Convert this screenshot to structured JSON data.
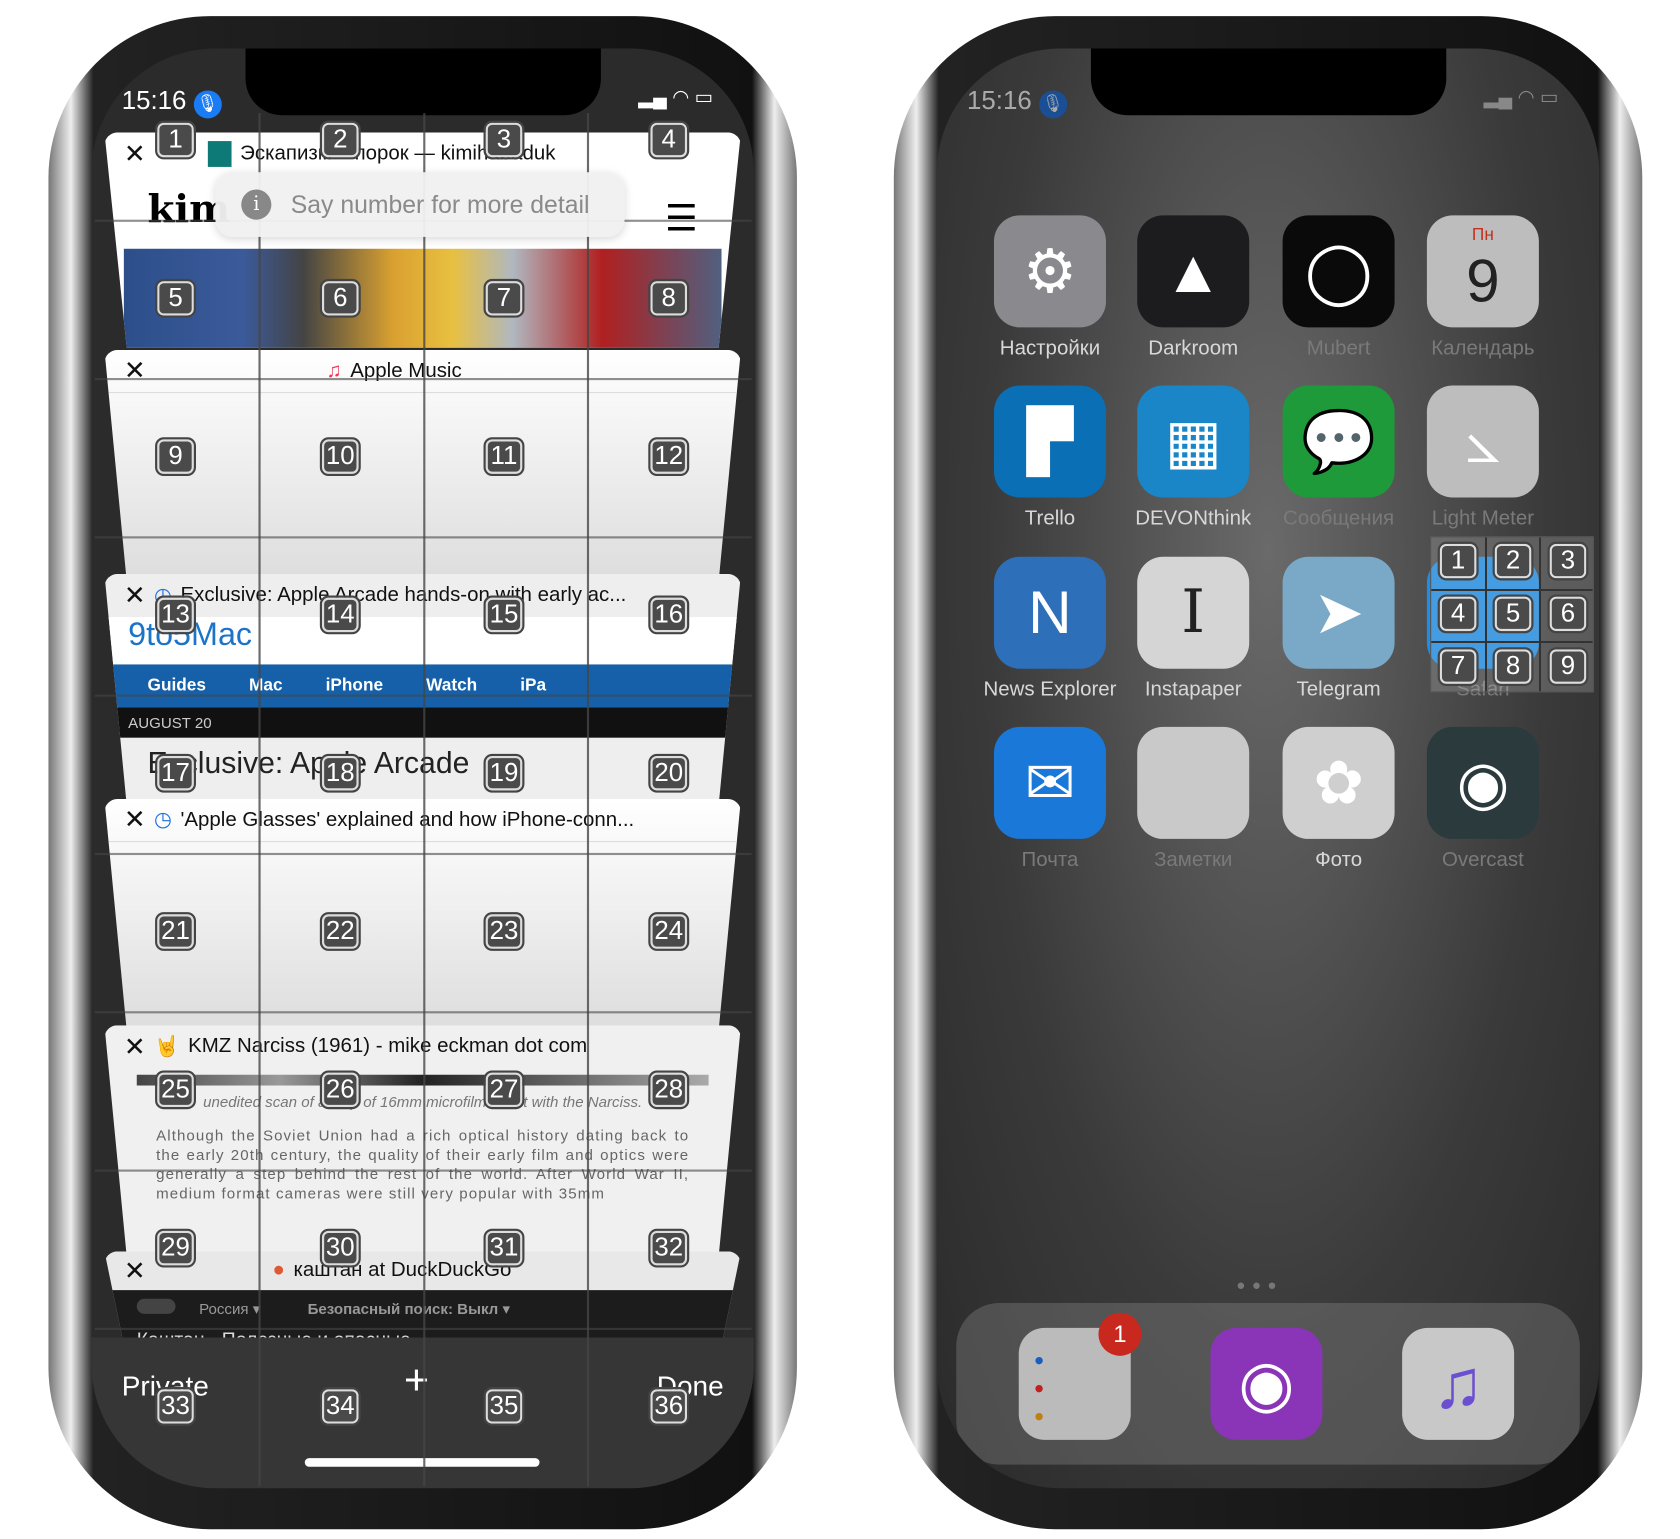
{
  "left_phone": {
    "status": {
      "time": "15:16",
      "mic_icon": "microphone-icon"
    },
    "tooltip": {
      "text": "Say number for more detail",
      "icon": "info-icon"
    },
    "tabs": [
      {
        "title": "Эскапизм – порок — kimihabaduk",
        "logo": "kim"
      },
      {
        "title": "Apple Music"
      },
      {
        "title": "Exclusive: Apple Arcade hands-on with early ac...",
        "site": "9to5Mac",
        "nav": [
          "Guides",
          "Mac",
          "iPhone",
          "Watch",
          "iPa"
        ],
        "date": "AUGUST 20",
        "headline": "Exclusive: Apple Arcade"
      },
      {
        "title": "'Apple Glasses' explained and how iPhone-conn..."
      },
      {
        "title": "KMZ Narciss (1961) - mike eckman dot com",
        "caption": "unedited scan of a strip of 16mm microfilm I shot with the Narciss.",
        "body": "Although the Soviet Union had a rich optical history dating back to the early 20th century, the quality of their early film and optics were generally a step behind the rest of the world. After World War II, medium format cameras were still very popular with 35mm"
      },
      {
        "title": "каштан at DuckDuckGo",
        "region": "Россия",
        "safe_search": "Безопасный поиск: Выкл",
        "result": "Каштан - Полезные и опасные"
      }
    ],
    "toolbar": {
      "private": "Private",
      "new_tab": "+",
      "done": "Done"
    },
    "grid_numbers": [
      "1",
      "2",
      "3",
      "4",
      "5",
      "6",
      "7",
      "8",
      "9",
      "10",
      "11",
      "12",
      "13",
      "14",
      "15",
      "16",
      "17",
      "18",
      "19",
      "20",
      "21",
      "22",
      "23",
      "24",
      "25",
      "26",
      "27",
      "28",
      "29",
      "30",
      "31",
      "32",
      "33",
      "34",
      "35",
      "36"
    ]
  },
  "right_phone": {
    "status": {
      "time": "15:16"
    },
    "apps": [
      {
        "name": "Настройки",
        "color": "#8a8a8e"
      },
      {
        "name": "Darkroom",
        "color": "#1c1c1e"
      },
      {
        "name": "Mubert",
        "color": "#0a0a0a"
      },
      {
        "name": "Календарь",
        "color": "#bdbdbd",
        "day": "Пн",
        "date": "9"
      },
      {
        "name": "Trello",
        "color": "#0a6fb5"
      },
      {
        "name": "DEVONthink",
        "color": "#1a86c8"
      },
      {
        "name": "Сообщения",
        "color": "#1e9a3a"
      },
      {
        "name": "Light Meter",
        "color": "#bdbdbd"
      },
      {
        "name": "News Explorer",
        "color": "#2d6fb8"
      },
      {
        "name": "Instapaper",
        "color": "#d5d5d5"
      },
      {
        "name": "Telegram",
        "color": "#7aa9c8"
      },
      {
        "name": "Safari",
        "color": "#1a8ee8"
      },
      {
        "name": "Почта",
        "color": "#1a78d8"
      },
      {
        "name": "Заметки",
        "color": "#c9c9c9"
      },
      {
        "name": "Фото",
        "color": "#cfcfcf"
      },
      {
        "name": "Overcast",
        "color": "#2b3a3d"
      }
    ],
    "dock": [
      {
        "name": "Напоминания",
        "badge": "1"
      },
      {
        "name": "Подкасты"
      },
      {
        "name": "Музыка"
      }
    ],
    "grid_numbers": [
      "1",
      "2",
      "3",
      "4",
      "5",
      "6",
      "7",
      "8",
      "9"
    ]
  }
}
